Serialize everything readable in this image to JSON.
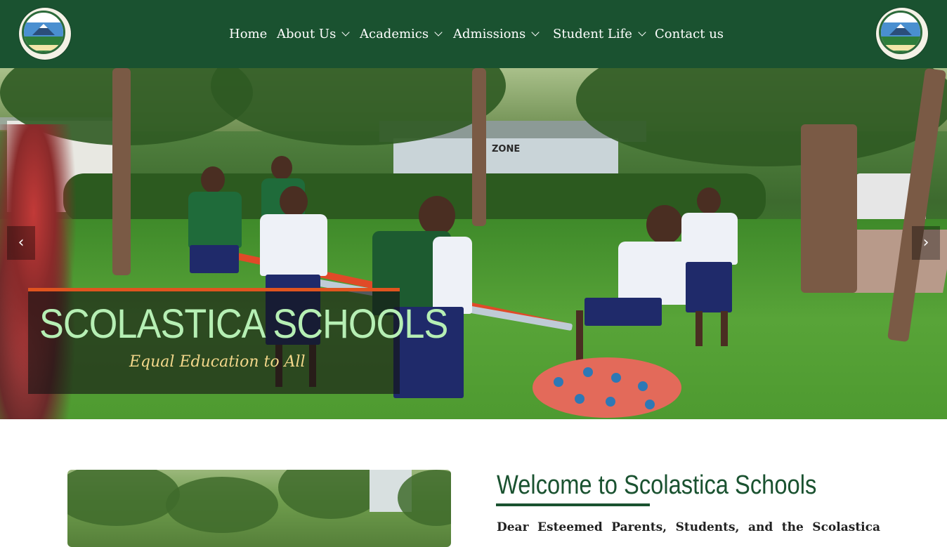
{
  "header": {
    "logo_left_icon": "school-crest-logo",
    "logo_right_icon": "school-crest-logo",
    "background": "#1a5230"
  },
  "nav": {
    "items": [
      {
        "label": "Home",
        "has_dropdown": false
      },
      {
        "label": "About Us",
        "has_dropdown": true
      },
      {
        "label": "Academics",
        "has_dropdown": true
      },
      {
        "label": "Admissions",
        "has_dropdown": true
      },
      {
        "label": "Student Life",
        "has_dropdown": true
      },
      {
        "label": "Contact us",
        "has_dropdown": false
      }
    ]
  },
  "hero": {
    "title": "SCOLASTICA SCHOOLS",
    "subtitle": "Equal Education to All",
    "prev_label": "‹",
    "next_label": "›",
    "sign_text": "ZONE",
    "accent": "#e0541f",
    "title_color": "#b6efb4",
    "subtitle_color": "#f2d78a"
  },
  "welcome": {
    "title": "Welcome to Scolastica Schools",
    "text": "Dear Esteemed Parents, Students, and the Scolastica"
  }
}
